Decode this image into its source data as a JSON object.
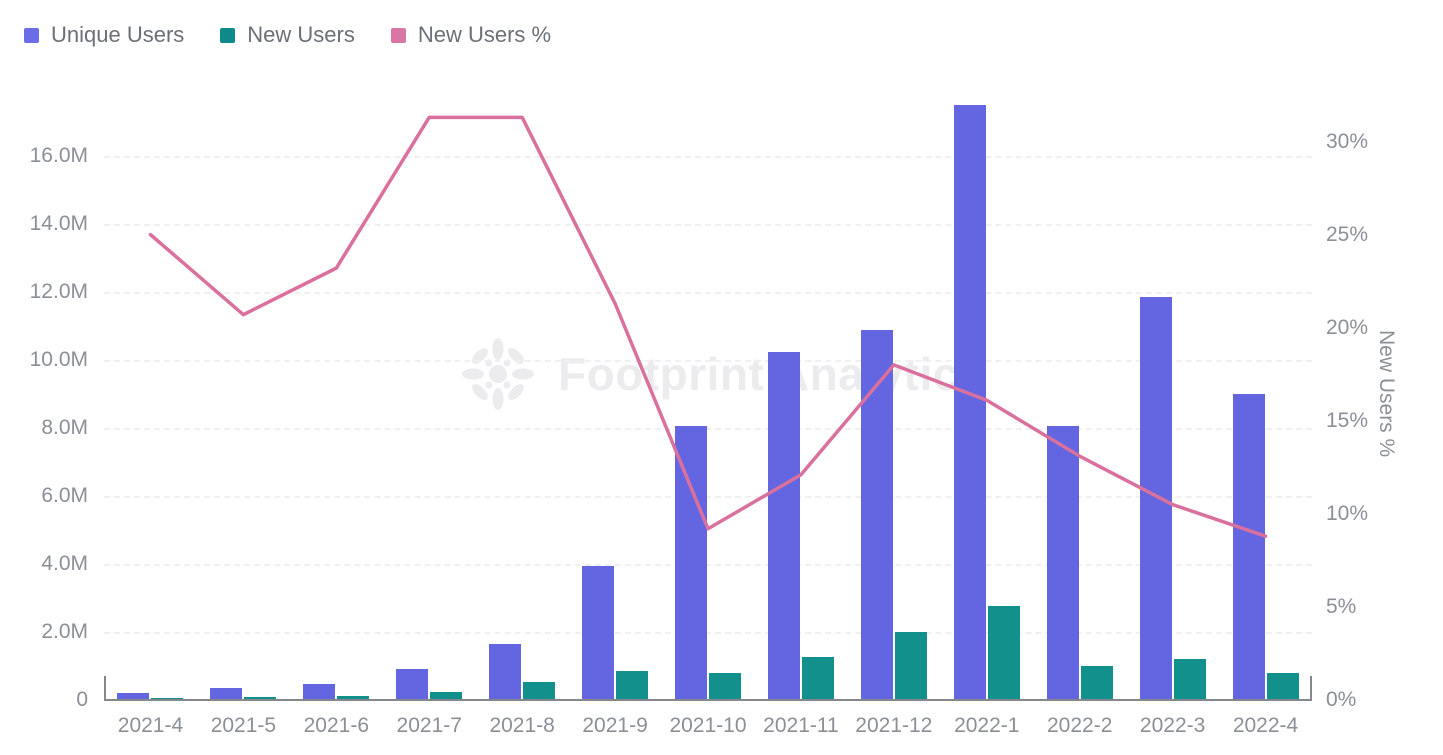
{
  "legend": {
    "position": "top-left",
    "entries": [
      {
        "label": "Unique Users",
        "color": "#6c6ce8",
        "icon": "square-swatch-icon"
      },
      {
        "label": "New Users",
        "color": "#0f8a8a",
        "icon": "square-swatch-icon"
      },
      {
        "label": "New Users %",
        "color": "#d976a5",
        "icon": "square-swatch-icon"
      }
    ]
  },
  "watermark": {
    "text": "Footprint Analytics",
    "logo": "flower-logo-icon",
    "color": "#ececee"
  },
  "axes": {
    "left": {
      "ticks": [
        "0",
        "2.0M",
        "4.0M",
        "6.0M",
        "8.0M",
        "10.0M",
        "12.0M",
        "14.0M",
        "16.0M"
      ],
      "title": ""
    },
    "right": {
      "ticks": [
        "0%",
        "5%",
        "10%",
        "15%",
        "20%",
        "25%",
        "30%"
      ],
      "title": "New Users %"
    },
    "bottom": {
      "ticks": [
        "2021-4",
        "2021-5",
        "2021-6",
        "2021-7",
        "2021-8",
        "2021-9",
        "2021-10",
        "2021-11",
        "2021-12",
        "2022-1",
        "2022-2",
        "2022-3",
        "2022-4"
      ]
    }
  },
  "chart_data": {
    "type": "bar",
    "title": "",
    "subtitle": "",
    "xlabel": "",
    "ylabel": "",
    "y2label": "New Users %",
    "grid": true,
    "legend_position": "top-left",
    "categories": [
      "2021-4",
      "2021-5",
      "2021-6",
      "2021-7",
      "2021-8",
      "2021-9",
      "2021-10",
      "2021-11",
      "2021-12",
      "2022-1",
      "2022-2",
      "2022-3",
      "2022-4"
    ],
    "ylim": [
      0,
      17800000
    ],
    "y2lim": [
      0,
      32.5
    ],
    "yticks": [
      0,
      2000000,
      4000000,
      6000000,
      8000000,
      10000000,
      12000000,
      14000000,
      16000000
    ],
    "y2ticks": [
      0,
      5,
      10,
      15,
      20,
      25,
      30
    ],
    "series": [
      {
        "name": "Unique Users",
        "type": "bar",
        "axis": "left",
        "color": "#6366e0",
        "values": [
          200000,
          350000,
          460000,
          900000,
          1650000,
          3950000,
          8050000,
          10250000,
          10900000,
          17500000,
          8050000,
          11850000,
          9000000
        ]
      },
      {
        "name": "New Users",
        "type": "bar",
        "axis": "left",
        "color": "#12908c",
        "values": [
          50000,
          100000,
          120000,
          250000,
          530000,
          860000,
          800000,
          1280000,
          1990000,
          2770000,
          1010000,
          1210000,
          790000
        ]
      },
      {
        "name": "New Users %",
        "type": "line",
        "axis": "right",
        "color": "#d9709e",
        "values": [
          25.0,
          20.7,
          23.2,
          31.3,
          31.3,
          21.3,
          9.2,
          12.1,
          18.0,
          16.1,
          13.1,
          10.5,
          8.8
        ]
      }
    ]
  }
}
